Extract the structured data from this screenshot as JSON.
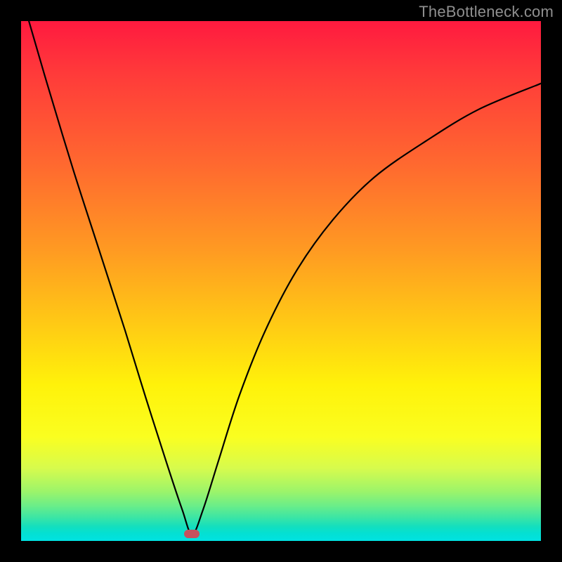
{
  "watermark": "TheBottleneck.com",
  "marker": {
    "x_fraction": 0.329,
    "y_fraction": 0.987,
    "color": "#c6515d"
  },
  "chart_data": {
    "type": "line",
    "title": "",
    "xlabel": "",
    "ylabel": "",
    "xlim": [
      0,
      1
    ],
    "ylim": [
      0,
      1
    ],
    "note": "Axes unlabeled; values are fractional positions inside the plot box. Y is bottleneck severity (0 = none, near bottom; 1 = max, at top). Minimum at x≈0.329.",
    "series": [
      {
        "name": "curve",
        "x": [
          0.015,
          0.05,
          0.1,
          0.15,
          0.2,
          0.24,
          0.28,
          0.31,
          0.329,
          0.35,
          0.38,
          0.42,
          0.47,
          0.53,
          0.6,
          0.68,
          0.78,
          0.88,
          1.0
        ],
        "y": [
          1.0,
          0.88,
          0.715,
          0.56,
          0.405,
          0.275,
          0.15,
          0.06,
          0.013,
          0.06,
          0.155,
          0.28,
          0.405,
          0.52,
          0.618,
          0.7,
          0.77,
          0.83,
          0.88
        ]
      }
    ],
    "background_gradient_note": "green at bottom through yellow/orange to red at top indicates severity"
  }
}
